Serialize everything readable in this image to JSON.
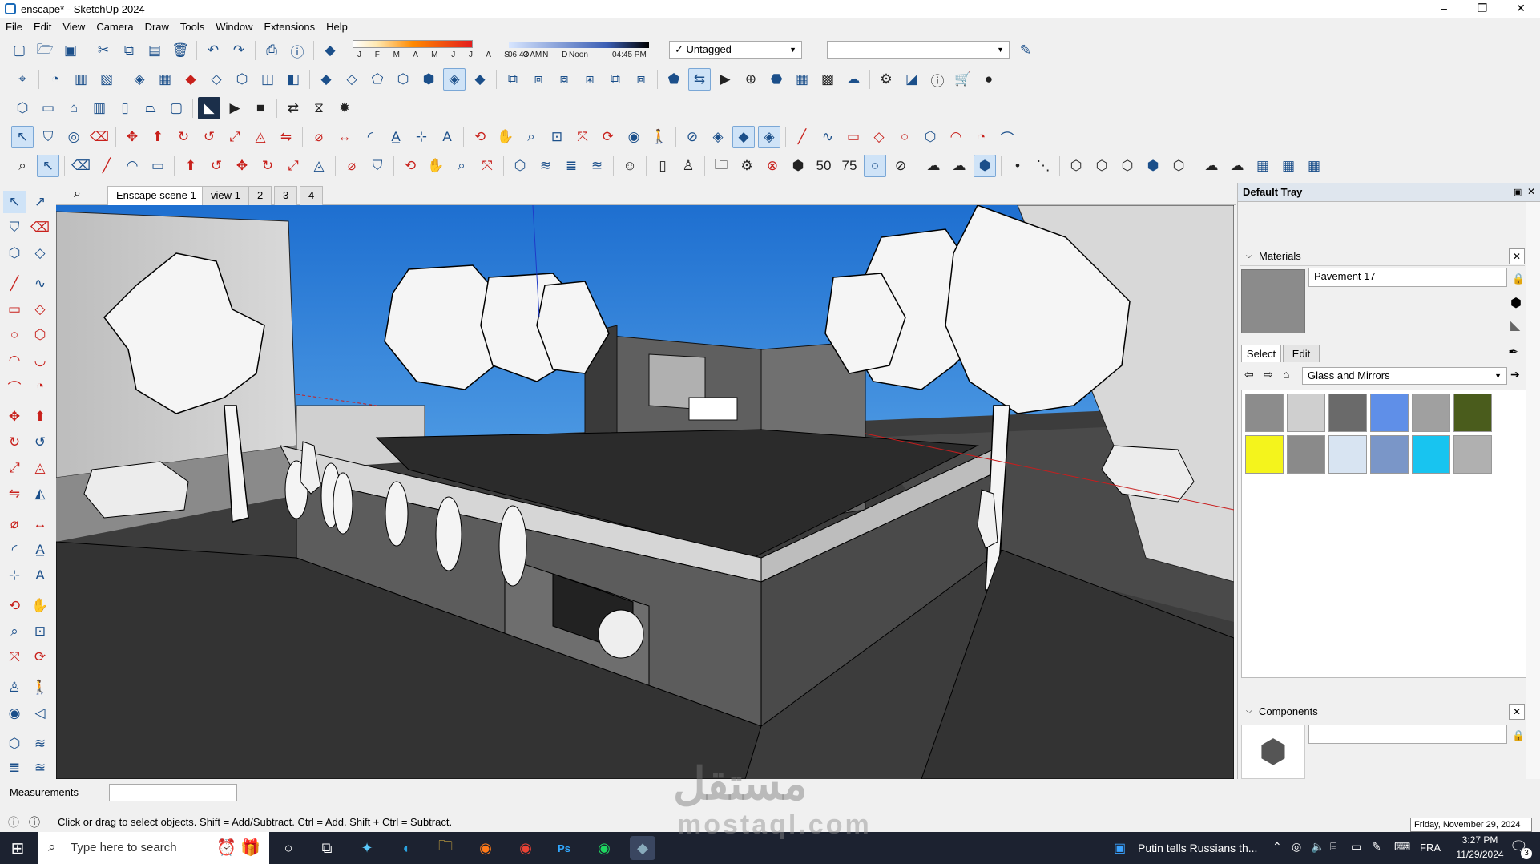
{
  "window": {
    "title": "enscape* - SketchUp 2024",
    "controls": [
      "–",
      "❐",
      "✕"
    ]
  },
  "menu": [
    "File",
    "Edit",
    "View",
    "Camera",
    "Draw",
    "Tools",
    "Window",
    "Extensions",
    "Help"
  ],
  "shadows": {
    "months": "J F M A M J J A S O N D",
    "time_start": "06:43 AM",
    "time_mid": "Noon",
    "time_end": "04:45 PM"
  },
  "tag_combo": {
    "check": "✓",
    "value": "Untagged"
  },
  "style_combo": {
    "value": ""
  },
  "scene_tabs": [
    {
      "label": "Enscape scene 1"
    },
    {
      "label": "view 1"
    },
    {
      "label": "2"
    },
    {
      "label": "3"
    },
    {
      "label": "4"
    }
  ],
  "tray": {
    "title": "Default Tray",
    "materials": {
      "header": "Materials",
      "material_name": "Pavement 17",
      "tabs": [
        "Select",
        "Edit"
      ],
      "library": "Glass and Mirrors",
      "swatch_colors": [
        "#8c8c8c",
        "#cfcfcf",
        "#6a6a6a",
        "#5f8fe8",
        "#a0a0a0",
        "#4a5c1c",
        "#f4f41c",
        "#8a8a8a",
        "#d8e4f2",
        "#7a96c8",
        "#18c4f0",
        "#b0b0b0"
      ]
    },
    "components": {
      "header": "Components",
      "search_value": ""
    }
  },
  "measurements": {
    "label": "Measurements",
    "value": ""
  },
  "status": {
    "hint": "Click or drag to select objects. Shift = Add/Subtract. Ctrl = Add. Shift + Ctrl = Subtract."
  },
  "taskbar": {
    "search_placeholder": "Type here to search",
    "news": "Putin tells Russians th...",
    "language": "FRA",
    "time": "3:27 PM",
    "date": "11/29/2024",
    "date_tooltip": "Friday, November 29, 2024",
    "notification_count": "3"
  },
  "watermark": {
    "arabic": "مستقل",
    "latin": "mostaql.com"
  },
  "colors": {
    "accent": "#1b4f8a",
    "tool_red": "#c8201b",
    "sky_top": "#1e6fd0",
    "taskbar": "#1c2230"
  }
}
